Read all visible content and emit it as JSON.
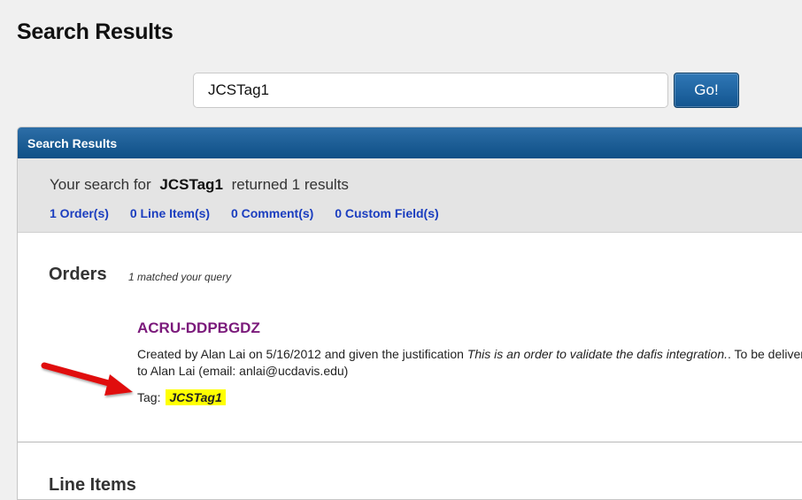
{
  "page": {
    "title": "Search Results"
  },
  "search": {
    "value": "JCSTag1",
    "button_label": "Go!"
  },
  "results_panel": {
    "header": "Search Results",
    "summary": {
      "prefix": "Your search for",
      "term": "JCSTag1",
      "suffix": "returned 1 results"
    },
    "links": [
      "1 Order(s)",
      "0 Line Item(s)",
      "0 Comment(s)",
      "0 Custom Field(s)"
    ]
  },
  "orders": {
    "title": "Orders",
    "match_note": "1 matched your query",
    "item": {
      "id": "ACRU-DDPBGDZ",
      "desc_before": "Created by Alan Lai on 5/16/2012 and given the justification",
      "desc_justification": "This is an order to validate the dafis integration.",
      "desc_after": ". To be delivered",
      "desc_line2": "to Alan Lai (email: anlai@ucdavis.edu)",
      "tag_label": "Tag:",
      "tag_value": "JCSTag1"
    }
  },
  "line_items": {
    "title": "Line Items"
  },
  "colors": {
    "header_blue": "#0e4f86",
    "order_link_purple": "#7b1a7b",
    "link_blue": "#1a3dbf",
    "tag_highlight": "#ffff00",
    "arrow_red": "#e01010"
  },
  "icons": {
    "arrow": "red-arrow-annotation-icon"
  }
}
